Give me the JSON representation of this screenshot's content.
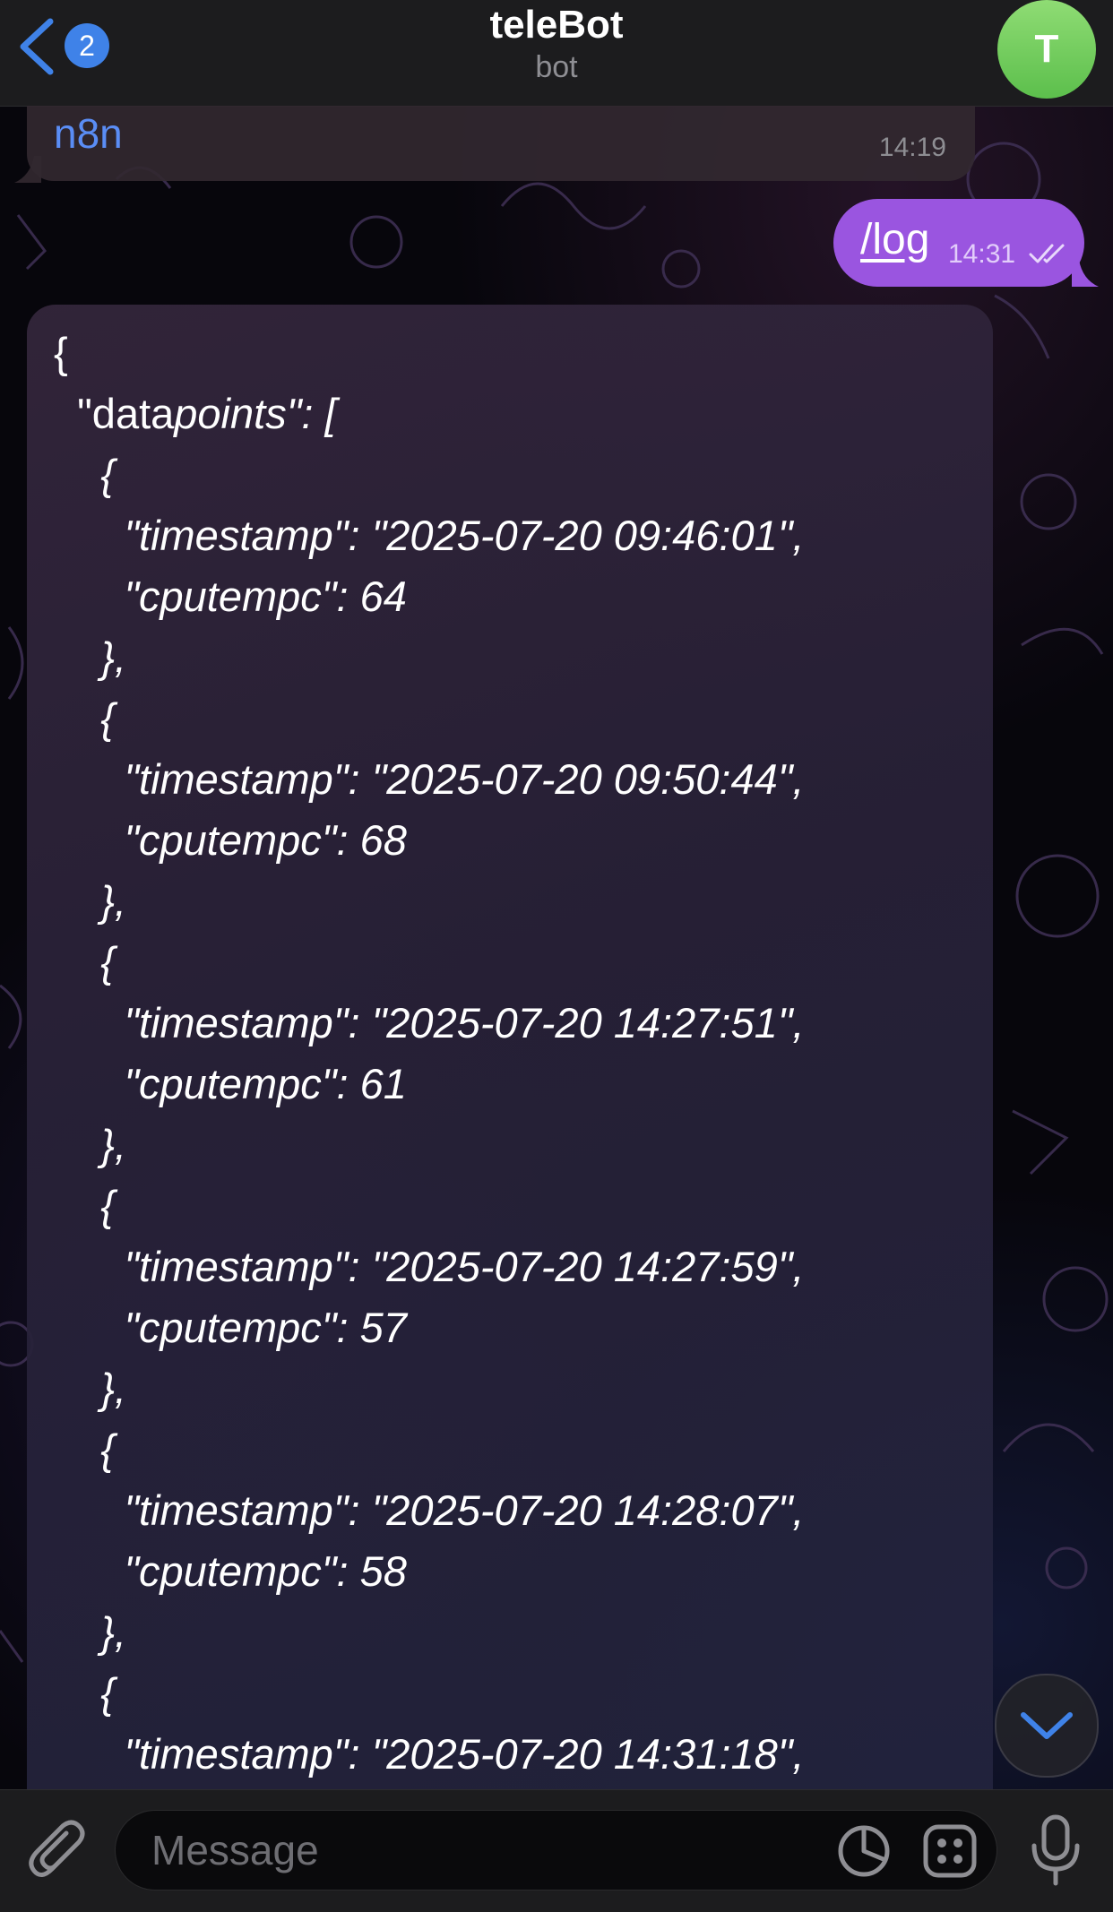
{
  "header": {
    "back_badge": "2",
    "title": "teleBot",
    "subtitle": "bot",
    "avatar_letter": "T"
  },
  "messages": {
    "incoming_top": {
      "text": "n8n",
      "time": "14:19"
    },
    "outgoing": {
      "text": "/log",
      "time": "14:31",
      "status": "read"
    },
    "json_reply_lines": [
      "{",
      "  \"data",
      "    {",
      "      \"timestamp\": \"2025-07-20 09:46:01\",",
      "      \"cputempc\": 64",
      "    },",
      "    {",
      "      \"timestamp\": \"2025-07-20 09:50:44\",",
      "      \"cputempc\": 68",
      "    },",
      "    {",
      "      \"timestamp\": \"2025-07-20 14:27:51\",",
      "      \"cputempc\": 61",
      "    },",
      "    {",
      "      \"timestamp\": \"2025-07-20 14:27:59\",",
      "      \"cputempc\": 57",
      "    },",
      "    {",
      "      \"timestamp\": \"2025-07-20 14:28:07\",",
      "      \"cputempc\": 58",
      "    },",
      "    {",
      "      \"timestamp\": \"2025-07-20 14:31:18\","
    ],
    "json_second_line_rest": "points\": ["
  },
  "input": {
    "placeholder": "Message"
  },
  "icons": {
    "back": "chevron-left-icon",
    "scroll_down": "chevron-down-icon",
    "attach": "paperclip-icon",
    "sticker": "sticker-icon",
    "apps": "apps-grid-icon",
    "mic": "microphone-icon"
  },
  "colors": {
    "accent": "#3f82e8",
    "outgoing_bubble": "#9a55e0",
    "link": "#5a8df5",
    "avatar": "#6fcf5b"
  }
}
